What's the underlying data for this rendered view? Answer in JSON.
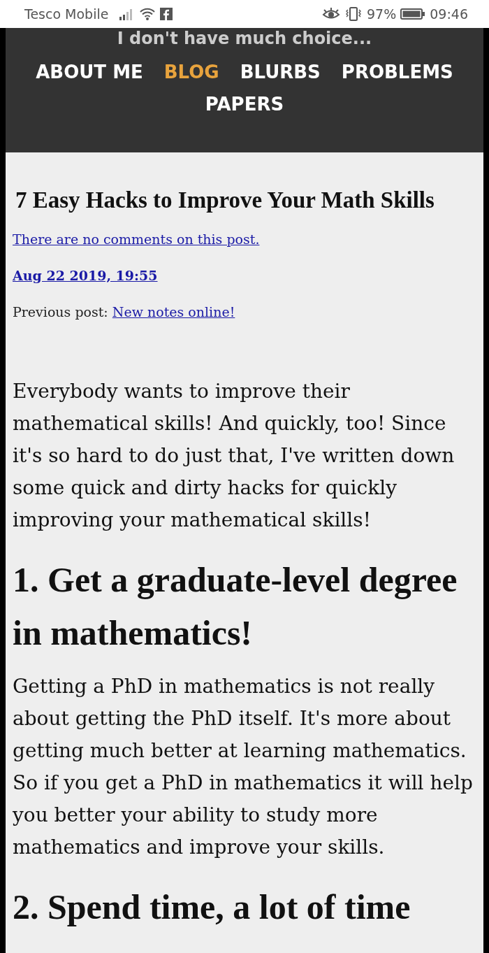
{
  "status_bar": {
    "carrier": "Tesco Mobile",
    "battery": "97%",
    "time": "09:46"
  },
  "header": {
    "tagline": "I don't have much choice...",
    "nav": [
      {
        "label": "ABOUT ME",
        "selected": false
      },
      {
        "label": "BLOG",
        "selected": true
      },
      {
        "label": "BLURBS",
        "selected": false
      },
      {
        "label": "PROBLEMS",
        "selected": false
      },
      {
        "label": "PAPERS",
        "selected": false
      }
    ]
  },
  "post": {
    "title": "7 Easy Hacks to Improve Your Math Skills",
    "comments_link": "There are no comments on this post.",
    "date_link": "Aug 22 2019, 19:55",
    "previous_label": "Previous post:",
    "previous_link": "New notes online!",
    "intro": "Everybody wants to improve their mathematical skills! And quickly, too! Since it's so hard to do just that, I've written down some quick and dirty hacks for quickly improving your mathematical skills!",
    "sections": [
      {
        "heading": "1. Get a graduate-level degree in mathematics!",
        "text": "Getting a PhD in mathematics is not really about getting the PhD itself. It's more about getting much better at learning mathematics. So if you get a PhD in mathematics it will help you better your ability to study more mathematics and improve your skills."
      },
      {
        "heading": "2. Spend time, a lot of time"
      }
    ]
  }
}
